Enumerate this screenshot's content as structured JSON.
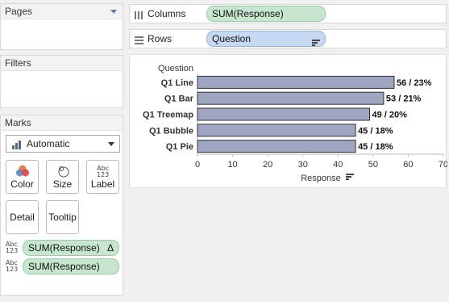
{
  "pages": {
    "title": "Pages"
  },
  "filters": {
    "title": "Filters"
  },
  "marks": {
    "title": "Marks",
    "mark_type": "Automatic",
    "buttons": {
      "color": "Color",
      "size": "Size",
      "label": "Label",
      "detail": "Detail",
      "tooltip": "Tooltip"
    },
    "label_icon_text": "Abc\n123",
    "fields": [
      {
        "type_icon": "Abc\n123",
        "name": "SUM(Response)",
        "delta": "Δ"
      },
      {
        "type_icon": "Abc\n123",
        "name": "SUM(Response)"
      }
    ]
  },
  "columns": {
    "label": "Columns",
    "pill": "SUM(Response)"
  },
  "rows": {
    "label": "Rows",
    "pill": "Question"
  },
  "chart_data": {
    "type": "bar",
    "orientation": "horizontal",
    "ylabel": "Question",
    "xlabel": "Response",
    "categories": [
      "Q1 Line",
      "Q1 Bar",
      "Q1 Treemap",
      "Q1 Bubble",
      "Q1 Pie"
    ],
    "values": [
      56,
      53,
      49,
      45,
      45
    ],
    "data_labels": [
      "56 / 23%",
      "53 / 21%",
      "49 / 20%",
      "45 / 18%",
      "45 / 18%"
    ],
    "xlim": [
      0,
      70
    ],
    "xticks": [
      0,
      10,
      20,
      30,
      40,
      50,
      60,
      70
    ],
    "bar_color": "#9ea6c2",
    "bar_border": "#333333"
  }
}
